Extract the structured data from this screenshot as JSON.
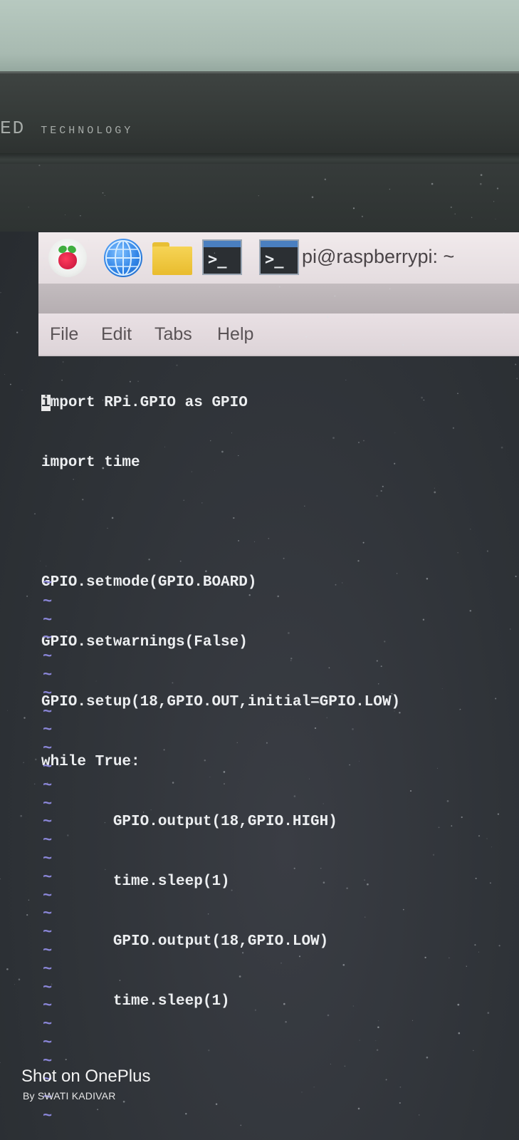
{
  "bezel": {
    "brand_left": "ED",
    "brand_text": "TECHNOLOGY"
  },
  "taskbar": {
    "icons": [
      "raspberry-pi-menu-icon",
      "web-browser-globe-icon",
      "file-manager-folder-icon",
      "terminal-icon",
      "terminal-window-icon"
    ],
    "terminal_prompt": ">_",
    "window_title": "pi@raspberrypi: ~"
  },
  "menubar": {
    "file": "File",
    "edit": "Edit",
    "tabs": "Tabs",
    "help": "Help"
  },
  "editor": {
    "cursor_char": "i",
    "lines": [
      "mport RPi.GPIO as GPIO",
      "import time",
      "",
      "GPIO.setmode(GPIO.BOARD)",
      "GPIO.setwarnings(False)",
      "GPIO.setup(18,GPIO.OUT,initial=GPIO.LOW)",
      "while True:",
      "        GPIO.output(18,GPIO.HIGH)",
      "        time.sleep(1)",
      "        GPIO.output(18,GPIO.LOW)",
      "        time.sleep(1)"
    ],
    "empty_line_marker": "~"
  },
  "watermark": {
    "title": "Shot on OnePlus",
    "subtitle": "By SWATI KADIVAR"
  },
  "colors": {
    "terminal_bg": "#2f3338",
    "code_text": "#eceef0",
    "tilde": "#8a86d8",
    "taskbar": "#ece5e8"
  }
}
